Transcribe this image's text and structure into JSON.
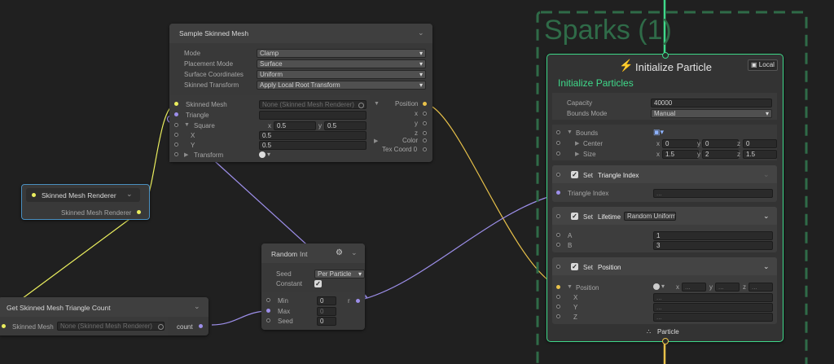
{
  "sample_skinned_mesh": {
    "title": "Sample Skinned Mesh",
    "settings": [
      {
        "label": "Mode",
        "value": "Clamp"
      },
      {
        "label": "Placement Mode",
        "value": "Surface"
      },
      {
        "label": "Surface Coordinates",
        "value": "Uniform"
      },
      {
        "label": "Skinned Transform",
        "value": "Apply Local Root Transform"
      }
    ],
    "inputs": {
      "skinned_mesh": "Skinned Mesh",
      "skinned_mesh_value": "None (Skinned Mesh Renderer)",
      "triangle": "Triangle",
      "square": "Square",
      "square_x": "0.5",
      "square_y": "0.5",
      "x_label": "X",
      "y_label": "Y",
      "x_value": "0.5",
      "y_value": "0.5",
      "transform": "Transform"
    },
    "outputs": {
      "position": "Position",
      "x": "x",
      "y": "y",
      "z": "z",
      "color": "Color",
      "tex_coord": "Tex Coord 0"
    }
  },
  "skinned_mesh_renderer": {
    "title": "Skinned Mesh Renderer",
    "output": "Skinned Mesh Renderer"
  },
  "random": {
    "title": "Random",
    "type": "Int",
    "seed_label": "Seed",
    "seed_value": "Per Particle",
    "constant_label": "Constant",
    "min_label": "Min",
    "min_value": "0",
    "max_label": "Max",
    "max_value": "0",
    "seed2_label": "Seed",
    "seed2_value": "0",
    "output": "r"
  },
  "triangle_count": {
    "title": "Get Skinned Mesh Triangle Count",
    "input": "Skinned Mesh",
    "input_value": "None (Skinned Mesh Renderer)",
    "output": "count"
  },
  "system": {
    "title": "Sparks (1)"
  },
  "init_context": {
    "title": "Initialize Particle",
    "badge": "Local",
    "subtitle": "Initialize Particles",
    "capacity_label": "Capacity",
    "capacity_value": "40000",
    "bounds_mode_label": "Bounds Mode",
    "bounds_mode_value": "Manual",
    "bounds_label": "Bounds",
    "center_label": "Center",
    "center": {
      "x": "0",
      "y": "0",
      "z": "0"
    },
    "size_label": "Size",
    "size": {
      "x": "1.5",
      "y": "2",
      "z": "1.5"
    },
    "axis": {
      "x": "x",
      "y": "y",
      "z": "z"
    },
    "footer": "Particle"
  },
  "blocks": {
    "triangle_index": {
      "set": "Set",
      "name": "Triangle Index",
      "field": "Triangle Index",
      "value": "..."
    },
    "lifetime": {
      "set": "Set",
      "name": "Lifetime",
      "mode": "Random Uniform",
      "a_label": "A",
      "a_value": "1",
      "b_label": "B",
      "b_value": "3"
    },
    "position": {
      "set": "Set",
      "name": "Position",
      "field": "Position",
      "x": "X",
      "y": "Y",
      "z": "Z",
      "empty": "...",
      "axis": {
        "x": "x",
        "y": "y",
        "z": "z"
      }
    }
  },
  "colors": {
    "yellow": "#eaee5e",
    "purple": "#9d8fea",
    "orange": "#e9c24a",
    "green": "#3fd98a",
    "frame": "#2f6b48"
  }
}
